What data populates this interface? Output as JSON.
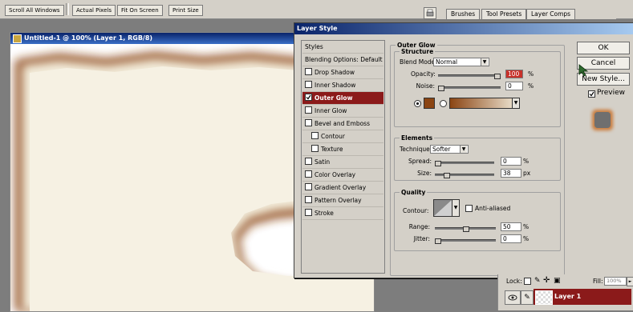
{
  "optbar": {
    "buttons": [
      "Scroll All Windows",
      "Actual Pixels",
      "Fit On Screen",
      "Print Size"
    ]
  },
  "panel_tabs": [
    "Brushes",
    "Tool Presets",
    "Layer Comps"
  ],
  "document": {
    "title": "Untitled-1 @ 100% (Layer 1, RGB/8)"
  },
  "dialog": {
    "title": "Layer Style",
    "styles_header": "Styles",
    "blending_options": "Blending Options: Default",
    "style_items": [
      "Drop Shadow",
      "Inner Shadow",
      "Outer Glow",
      "Inner Glow",
      "Bevel and Emboss",
      "Contour",
      "Texture",
      "Satin",
      "Color Overlay",
      "Gradient Overlay",
      "Pattern Overlay",
      "Stroke"
    ],
    "selected_style": "Outer Glow",
    "section_title": "Outer Glow",
    "structure": {
      "title": "Structure",
      "blend_mode_label": "Blend Mode:",
      "blend_mode_value": "Normal",
      "opacity_label": "Opacity:",
      "opacity_value": "100",
      "opacity_unit": "%",
      "opacity_level": 1.0,
      "noise_label": "Noise:",
      "noise_value": "0",
      "noise_unit": "%",
      "noise_level": 0.0,
      "glow_color": "#8b4513"
    },
    "elements": {
      "title": "Elements",
      "technique_label": "Technique:",
      "technique_value": "Softer",
      "spread_label": "Spread:",
      "spread_value": "0",
      "spread_unit": "%",
      "spread_level": 0.0,
      "size_label": "Size:",
      "size_value": "38",
      "size_unit": "px",
      "size_level": 0.15
    },
    "quality": {
      "title": "Quality",
      "contour_label": "Contour:",
      "antialiased_label": "Anti-aliased",
      "range_label": "Range:",
      "range_value": "50",
      "range_unit": "%",
      "range_level": 0.5,
      "jitter_label": "Jitter:",
      "jitter_value": "0",
      "jitter_unit": "%",
      "jitter_level": 0.0
    },
    "buttons": {
      "ok": "OK",
      "cancel": "Cancel",
      "new_style": "New Style...",
      "preview": "Preview"
    }
  },
  "layers": {
    "lock_label": "Lock:",
    "fill_label": "Fill:",
    "fill_value": "100%",
    "layer_name": "Layer 1"
  },
  "colors": {
    "selected_style_bg": "#8b1a1a",
    "title_bar": "#0a246a",
    "panel_bg": "#d4d0c8"
  }
}
